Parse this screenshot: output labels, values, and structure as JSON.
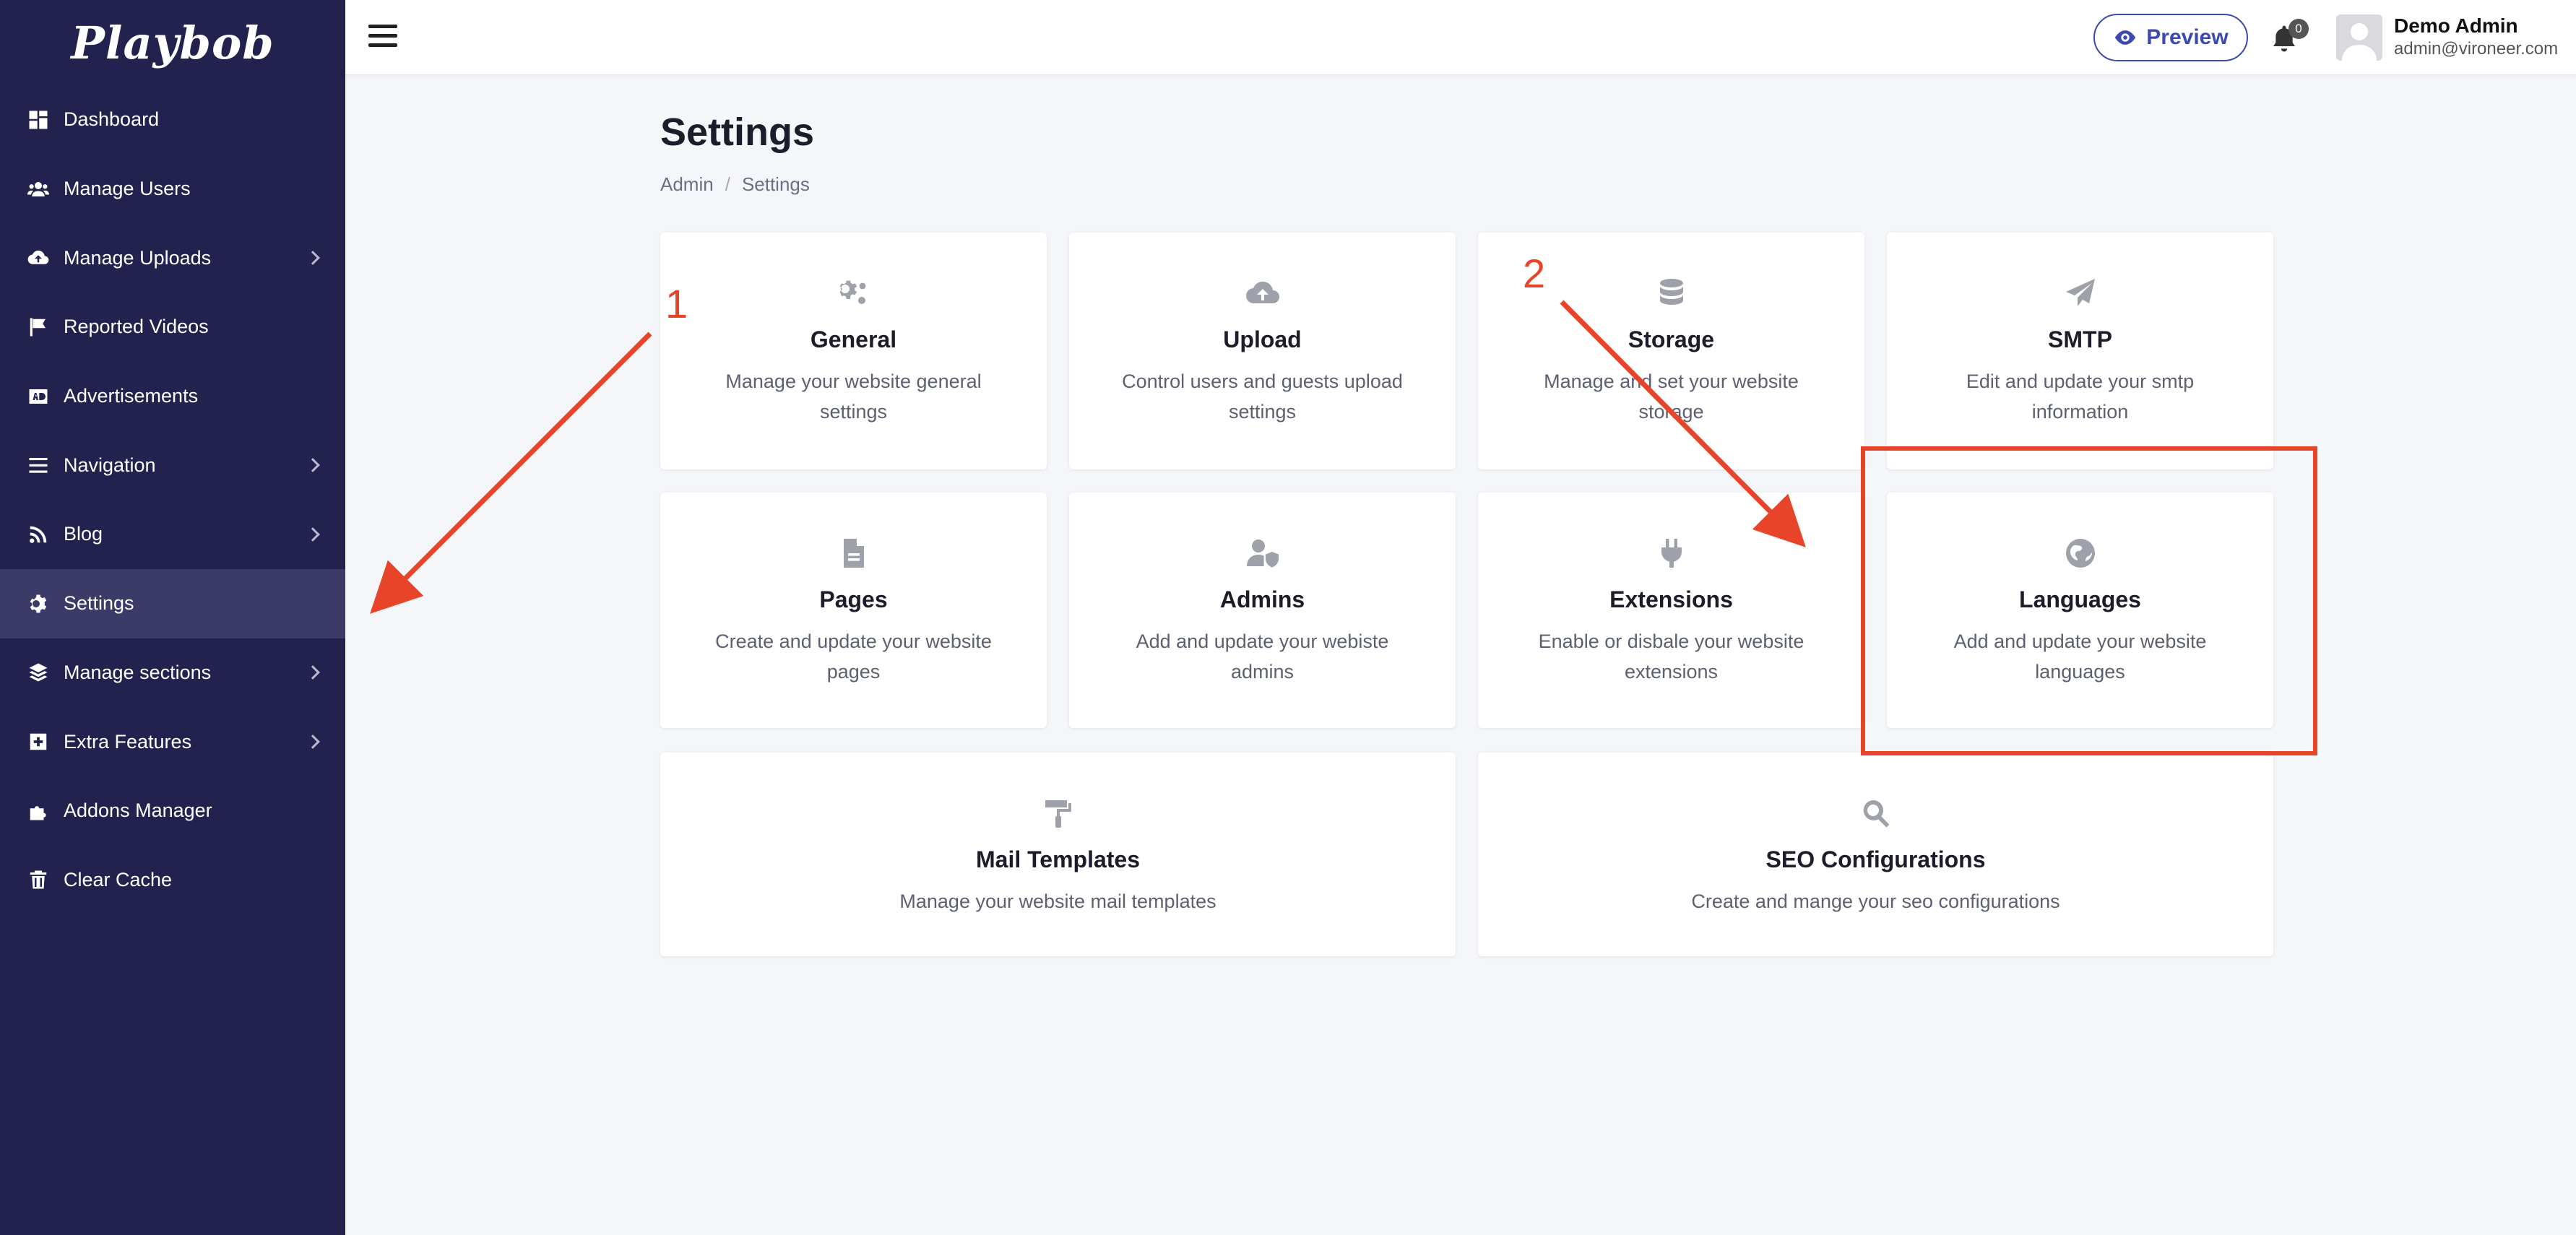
{
  "app": {
    "logo": "Playbob"
  },
  "sidebar": {
    "items": [
      {
        "label": "Dashboard",
        "icon": "dashboard-icon",
        "has_chevron": false,
        "active": false
      },
      {
        "label": "Manage Users",
        "icon": "users-icon",
        "has_chevron": false,
        "active": false
      },
      {
        "label": "Manage Uploads",
        "icon": "cloud-upload-icon",
        "has_chevron": true,
        "active": false
      },
      {
        "label": "Reported Videos",
        "icon": "flag-icon",
        "has_chevron": false,
        "active": false
      },
      {
        "label": "Advertisements",
        "icon": "ad-icon",
        "has_chevron": false,
        "active": false
      },
      {
        "label": "Navigation",
        "icon": "bars-icon",
        "has_chevron": true,
        "active": false
      },
      {
        "label": "Blog",
        "icon": "rss-icon",
        "has_chevron": true,
        "active": false
      },
      {
        "label": "Settings",
        "icon": "gear-icon",
        "has_chevron": false,
        "active": true
      },
      {
        "label": "Manage sections",
        "icon": "layers-icon",
        "has_chevron": true,
        "active": false
      },
      {
        "label": "Extra Features",
        "icon": "plus-square-icon",
        "has_chevron": true,
        "active": false
      },
      {
        "label": "Addons Manager",
        "icon": "puzzle-icon",
        "has_chevron": false,
        "active": false
      },
      {
        "label": "Clear Cache",
        "icon": "trash-icon",
        "has_chevron": false,
        "active": false
      }
    ]
  },
  "header": {
    "preview_label": "Preview",
    "notification_count": "0",
    "user_name": "Demo Admin",
    "user_email": "admin@vironeer.com"
  },
  "page": {
    "title": "Settings",
    "breadcrumb": [
      "Admin",
      "Settings"
    ]
  },
  "cards": [
    {
      "title": "General",
      "desc": "Manage your website general settings",
      "icon": "gears-icon"
    },
    {
      "title": "Upload",
      "desc": "Control users and guests upload settings",
      "icon": "cloud-upload-icon"
    },
    {
      "title": "Storage",
      "desc": "Manage and set your website storage",
      "icon": "database-icon"
    },
    {
      "title": "SMTP",
      "desc": "Edit and update your smtp information",
      "icon": "paper-plane-icon"
    },
    {
      "title": "Pages",
      "desc": "Create and update your website pages",
      "icon": "file-icon"
    },
    {
      "title": "Admins",
      "desc": "Add and update your webiste admins",
      "icon": "user-shield-icon"
    },
    {
      "title": "Extensions",
      "desc": "Enable or disbale your website extensions",
      "icon": "plug-icon"
    },
    {
      "title": "Languages",
      "desc": "Add and update your website languages",
      "icon": "globe-icon"
    },
    {
      "title": "Mail Templates",
      "desc": "Manage your website mail templates",
      "icon": "paint-roller-icon"
    },
    {
      "title": "SEO Configurations",
      "desc": "Create and mange your seo configurations",
      "icon": "search-icon"
    }
  ],
  "annotations": {
    "label_1": "1",
    "label_2": "2",
    "accent_color": "#e8442a"
  },
  "colors": {
    "sidebar_bg": "#23224f",
    "sidebar_active": "#3c3b68",
    "accent": "#3b4ab0"
  }
}
